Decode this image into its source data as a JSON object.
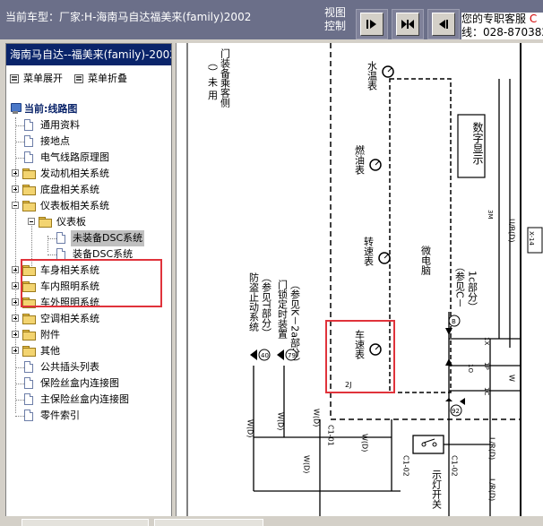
{
  "header": {
    "car_title": "当前车型：厂家:H-海南马自达福美来(family)2002",
    "view_control_label": "视图控制",
    "service_line1": "您的专职客服",
    "service_line1_red": "C",
    "service_line2": "线：028-870382"
  },
  "left_pane": {
    "title": "海南马自达--福美来(family)-2002",
    "menu_expand": "菜单展开",
    "menu_collapse": "菜单折叠",
    "tree": {
      "root": "当前:线路图",
      "items": [
        "通用资料",
        "接地点",
        "电气线路原理图",
        "发动机相关系统",
        "底盘相关系统",
        "仪表板相关系统",
        "仪表板",
        "未装备DSC系统",
        "装备DSC系统",
        "车身相关系统",
        "车内照明系统",
        "车外照明系统",
        "空调相关系统",
        "附件",
        "其他",
        "公共插头列表",
        "保险丝盒内连接图",
        "主保险丝盒内连接图",
        "零件索引"
      ]
    }
  },
  "diagram": {
    "labels": {
      "door_lamp_a": "门装备乘客侧",
      "door_lamp_b": "（）未 用",
      "water_temp_gauge": "水温表",
      "fuel_gauge": "燃油表",
      "tach": "转速表",
      "speedometer": "车速表",
      "digital_display": "数字显示",
      "microcomputer": "微电脑",
      "anti_theft_a": "防盗止动系统",
      "anti_theft_b": "（参见T部分）",
      "door_lock_a": "门锁定时装置",
      "door_lock_b": "（参见K－2a部分）",
      "ref_c_a": "（参见C－",
      "ref_c_b": "1c部分）",
      "lamp_switch": "示灯开关",
      "w_d": "W(D)",
      "w": "W",
      "c101": "C1-01",
      "c102": "C1-02",
      "lr_d": "L/R(D)",
      "ub_d": "U/B(D)",
      "x14": "X-14",
      "n2j": "2J",
      "n3m": "3M",
      "n1o": "1O",
      "n1p": "1P",
      "n1c": "1C",
      "n1x": "1X",
      "c40": "40",
      "c79": "79",
      "c92": "92",
      "cb": "B"
    }
  },
  "colors": {
    "title_bar": "#6b6f89",
    "left_title": "#0a246a",
    "highlight_box": "#e0333b",
    "service_red": "#d00000"
  }
}
